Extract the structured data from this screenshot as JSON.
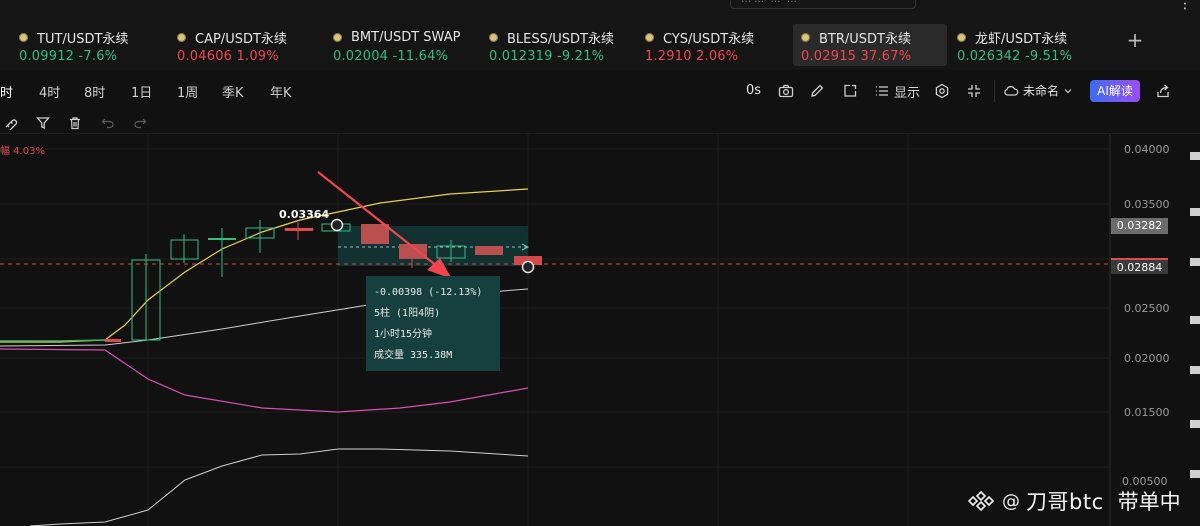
{
  "top_search": "…·… ·… ·…",
  "tickers": [
    {
      "name": "TUT/USDT永续",
      "price": "0.09912",
      "change": "-7.6%",
      "dir": "up",
      "active": false
    },
    {
      "name": "CAP/USDT永续",
      "price": "0.04606",
      "change": "1.09%",
      "dir": "down",
      "active": false
    },
    {
      "name": "BMT/USDT SWAP",
      "price": "0.02004",
      "change": "-11.64%",
      "dir": "up",
      "active": false
    },
    {
      "name": "BLESS/USDT永续",
      "price": "0.012319",
      "change": "-9.21%",
      "dir": "up",
      "active": false
    },
    {
      "name": "CYS/USDT永续",
      "price": "1.2910",
      "change": "2.06%",
      "dir": "down",
      "active": false
    },
    {
      "name": "BTR/USDT永续",
      "price": "0.02915",
      "change": "37.67%",
      "dir": "down",
      "active": true
    },
    {
      "name": "龙虾/USDT永续",
      "price": "0.026342",
      "change": "-9.51%",
      "dir": "up",
      "active": false
    }
  ],
  "add_tab": "+",
  "intervals": [
    "时",
    "4时",
    "8时",
    "1日",
    "1周",
    "季K",
    "年K"
  ],
  "toolbar": {
    "zero_s": "0s",
    "display": "显示",
    "unnamed": "未命名",
    "ai": "AI解读"
  },
  "chart": {
    "amplitude_label": "幅 4.03%",
    "high_label": "0.03364",
    "y_ticks": [
      "0.04000",
      "0.03500",
      "0.02500",
      "0.02000",
      "0.01500",
      "0.00500"
    ],
    "price_high": "0.03282",
    "price_last": "0.02884"
  },
  "measure": {
    "change": "-0.00398 (-12.13%)",
    "bars": "5柱 (1阳4阴)",
    "duration": "1小时15分钟",
    "volume": "成交量 335.38M"
  },
  "watermark": {
    "at": "@",
    "name": "刀哥btc",
    "suffix": "带单中"
  },
  "colors": {
    "up": "#2ebd85",
    "down": "#f0454f",
    "accent": "#3c6cf0",
    "measure_bg": "#16403f"
  },
  "icons": [
    "camera-icon",
    "pencil-icon",
    "external-icon",
    "list-icon",
    "settings-icon",
    "collapse-icon",
    "cloud-icon",
    "share-icon",
    "magnet-icon",
    "filter-icon",
    "trash-icon",
    "undo-icon",
    "redo-icon"
  ]
}
